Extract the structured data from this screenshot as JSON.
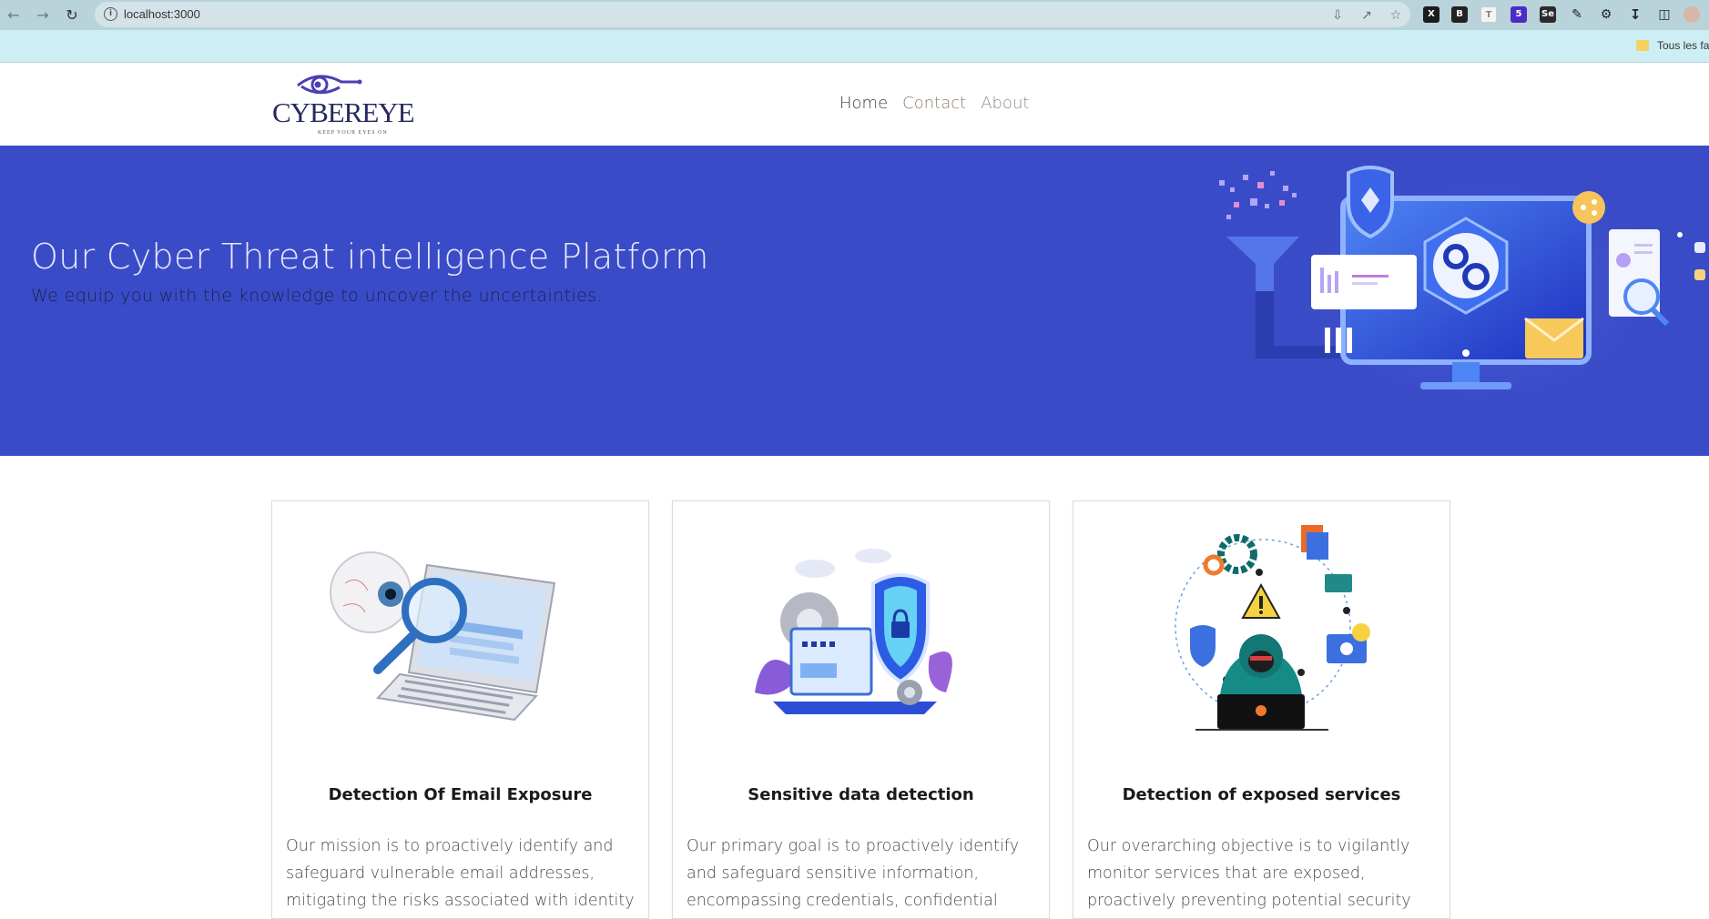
{
  "browser": {
    "url": "localhost:3000",
    "bookmarks_label": "Tous les favoris"
  },
  "site": {
    "logo": {
      "name": "CYBEREYE",
      "tagline": "KEEP YOUR EYES ON"
    },
    "nav": {
      "home": "Home",
      "contact": "Contact",
      "about": "About"
    },
    "hero": {
      "title": "Our Cyber Threat intelligence Platform",
      "subtitle": "We equip you with the knowledge to uncover the uncertainties."
    },
    "cards": [
      {
        "title": "Detection Of Email Exposure",
        "text": "Our mission is to proactively identify and safeguard vulnerable email addresses, mitigating the risks associated with identity"
      },
      {
        "title": "Sensitive data detection",
        "text": "Our primary goal is to proactively identify and safeguard sensitive information, encompassing credentials, confidential"
      },
      {
        "title": "Detection of exposed services",
        "text": "Our overarching objective is to vigilantly monitor services that are exposed, proactively preventing potential security"
      }
    ]
  },
  "colors": {
    "hero_bg": "#3a4bc8",
    "chrome_bg": "#b8d3da",
    "bookmarks_bg": "#cdeef5",
    "logo": "#262a5e"
  }
}
